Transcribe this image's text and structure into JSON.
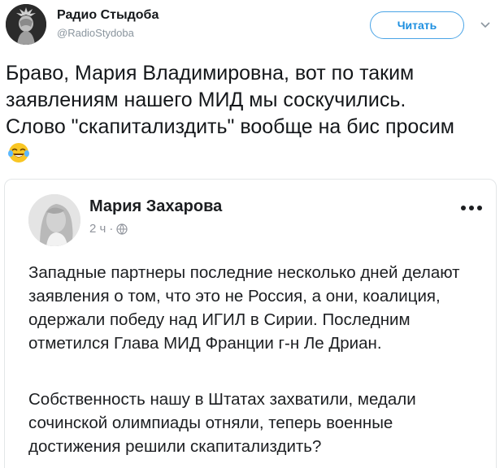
{
  "author": {
    "display_name": "Радио Стыдоба",
    "handle": "@RadioStydoba",
    "follow_label": "Читать"
  },
  "tweet": {
    "text": "Браво, Мария Владимировна, вот по таким заявлениям нашего МИД мы соскучились. Слово \"скапитализдить\" вообще на бис просим",
    "emoji": "face-with-tears-of-joy"
  },
  "quoted_post": {
    "author_name": "Мария Захарова",
    "time": "2 ч",
    "separator": "·",
    "paragraphs": [
      "Западные партнеры последние несколько дней делают заявления о том, что это не Россия, а они, коалиция, одержали победу над ИГИЛ в Сирии. Последним отметился Глава МИД Франции г-н Ле Дриан.",
      "Собственность нашу в Штатах захватили, медали сочинской олимпиады отняли, теперь военные достижения решили скапитализдить?"
    ]
  },
  "colors": {
    "accent": "#1d8fe0",
    "text": "#14171a",
    "muted": "#8a959e",
    "border": "#e3e6e8"
  }
}
